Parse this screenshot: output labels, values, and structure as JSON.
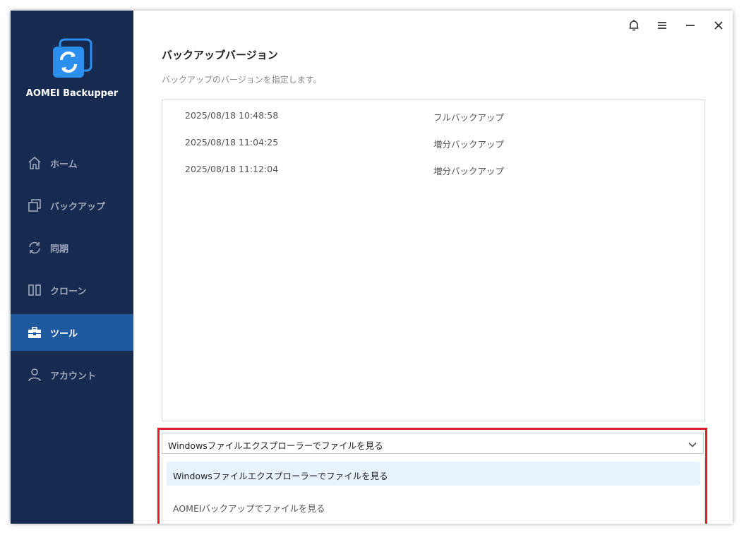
{
  "app": {
    "name": "AOMEI Backupper",
    "brand_color": "#2b8ff0"
  },
  "sidebar": {
    "items": [
      {
        "label": "ホーム",
        "icon": "home-icon",
        "active": false
      },
      {
        "label": "バックアップ",
        "icon": "backup-icon",
        "active": false
      },
      {
        "label": "同期",
        "icon": "sync-icon",
        "active": false
      },
      {
        "label": "クローン",
        "icon": "clone-icon",
        "active": false
      },
      {
        "label": "ツール",
        "icon": "toolbox-icon",
        "active": true
      },
      {
        "label": "アカウント",
        "icon": "account-icon",
        "active": false
      }
    ]
  },
  "topbar": {
    "icons": [
      "bell-icon",
      "menu-icon",
      "minimize-icon",
      "close-icon"
    ]
  },
  "page": {
    "title": "バックアップバージョン",
    "subtitle": "バックアップのバージョンを指定します。"
  },
  "versions": [
    {
      "date": "2025/08/18 10:48:58",
      "type": "フルバックアップ"
    },
    {
      "date": "2025/08/18 11:04:25",
      "type": "増分バックアップ"
    },
    {
      "date": "2025/08/18 11:12:04",
      "type": "増分バックアップ"
    }
  ],
  "view_select": {
    "value": "Windowsファイルエクスプローラーでファイルを見る",
    "options": [
      "Windowsファイルエクスプローラーでファイルを見る",
      "AOMEIバックアップでファイルを見る"
    ],
    "highlight_color": "#e01e2d"
  }
}
